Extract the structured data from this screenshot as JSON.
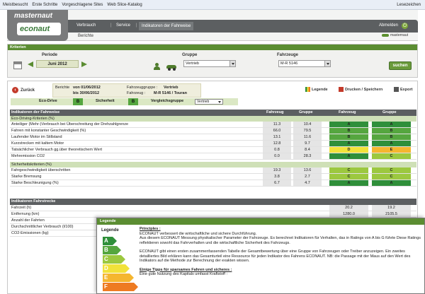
{
  "bookmarks": [
    "Meistbesucht",
    "Erste Schritte",
    "Vorgeschlagene Sites",
    "Web Slice-Katalog"
  ],
  "bookmarks_right": "Lesezeichen",
  "header": {
    "logo_top": "masternaut",
    "logo_bottom": "econaut",
    "nav": [
      "Verbrauch",
      "Service",
      "Indikatoren der Fahrweise"
    ],
    "logout": "Abmelden",
    "subnav": "Berichte",
    "brand": "masternaut"
  },
  "criteria": {
    "title": "Kriterien",
    "period_label": "Periode",
    "period_value": "Juni 2012",
    "group_label": "Gruppe",
    "group_value": "Vertrieb",
    "vehicle_label": "Fahrzeuge",
    "vehicle_value": "M-R 5146",
    "search_label": "suchen"
  },
  "report": {
    "back_label": "Zurück",
    "head": {
      "berichte": "Berichte",
      "von": "von 01/06/2012",
      "bis": "bis 30/06/2012",
      "fg_label": "Fahrzeuggruppe :",
      "fg_value": "Vertrieb",
      "fz_label": "Fahrzeug :",
      "fz_value": "M-R 5146 / Touran"
    },
    "tools": {
      "legend": "Legende",
      "print": "Drucken / Speichern",
      "export": "Export"
    },
    "summary": {
      "eco_label": "Eco-Drive",
      "eco_value": "B",
      "safety_label": "Sicherheit",
      "safety_value": "B",
      "compare_label": "Vergleichsgruppe",
      "compare_value": "Vertrieb"
    },
    "table_headers": [
      "Indikatoren der Fahrweise",
      "Fahrzeug",
      "Gruppe",
      "Fahrzeug",
      "Gruppe"
    ],
    "eco_section": "Eco-Driving-Kriterien (%)",
    "eco_rows": [
      {
        "name": "Anteiliger (Mehr-)Verbrauch bei Überschreitung der Drehzahlgrenze",
        "v1": "11.3",
        "v2": "10.4",
        "r1": "A",
        "r2": "A"
      },
      {
        "name": "Fahren mit konstanter Geschwindigkeit (%)",
        "v1": "66.0",
        "v2": "79.5",
        "r1": "B",
        "r2": "B"
      },
      {
        "name": "Laufender Motor im Stillstand",
        "v1": "13.1",
        "v2": "11.6",
        "r1": "B",
        "r2": "B"
      },
      {
        "name": "Kurzstrecken mit kaltem Motor",
        "v1": "12.8",
        "v2": "9.7",
        "r1": "A",
        "r2": "A"
      },
      {
        "name": "Tatsächlicher Verbrauch gg.über theoretischem Wert",
        "v1": "0.8",
        "v2": "8.4",
        "r1": "D",
        "r2": "E"
      },
      {
        "name": "Mehremission CO2",
        "v1": "0.0",
        "v2": "28.3",
        "r1": "A",
        "r2": "C"
      }
    ],
    "safety_section": "Sicherheitskriterien (%)",
    "safety_rows": [
      {
        "name": "Fahrgeschwindigkeit überschritten",
        "v1": "19.3",
        "v2": "13.6",
        "r1": "C",
        "r2": "C"
      },
      {
        "name": "Starke Bremsung",
        "v1": "3.8",
        "v2": "2.7",
        "r1": "C",
        "r2": "C"
      },
      {
        "name": "Starke Beschleunigung (%)",
        "v1": "6.7",
        "v2": "4.7",
        "r1": "A",
        "r2": "A"
      }
    ],
    "trip_header": "Indikatoren Fahrstrecke",
    "trip_rows": [
      {
        "name": "Fahrzeit (h)",
        "v1": "",
        "v2": "",
        "r1": "20.2",
        "r2": "19.2"
      },
      {
        "name": "Entfernung (km)",
        "v1": "",
        "v2": "",
        "r1": "1280.0",
        "r2": "2105.5"
      },
      {
        "name": "Anzahl der Fahrten",
        "v1": "",
        "v2": "",
        "r1": "",
        "r2": ""
      },
      {
        "name": "Durchschnittlicher Verbrauch (l/100)",
        "v1": "",
        "v2": "",
        "r1": "",
        "r2": ""
      },
      {
        "name": "CO2-Emissionen (kg)",
        "v1": "",
        "v2": "",
        "r1": "",
        "r2": ""
      }
    ]
  },
  "rating_colors": {
    "A": "#2f8f3a",
    "B": "#55a63f",
    "C": "#9cc83f",
    "D": "#f2e23a",
    "E": "#f5b62f",
    "F": "#ee7b22"
  },
  "legend_dialog": {
    "title": "Legende",
    "header": "Legende",
    "scale": [
      "A",
      "B",
      "C",
      "D",
      "E",
      "F"
    ],
    "principles_title": "Principles :",
    "principles_1": "ECONAUT verbessert die wirtschaftliche und sichere Durchführung.",
    "principles_2": "Aus diesem ECONAUT Messung physikalischer Parameter der Fahrzeuge. Es berechnet Indikatoren für Verhalten, das in Ratings von A bis G führte Diese Ratings reflektieren sowohl das Fahrverhalten und die wirtschaftliche Sicherheit des Fahrzeugs.",
    "para_2": "ECONAUT gibt einen ersten zusammenfassenden Tabelle der Gesamtbewertung über eine Gruppe von Fahrzeugen oder Treiber anzuzeigen. Ein zweites detailliertes Bild erklären kann das Gesamturteil eine Ressource für jeden Indikator des Fahrens ECONAUT. NB: die Passage mit der Maus auf den Wert des Indikators auf die Methode zur Berechnung der exakten wissen.",
    "tips_title": "Einige Tipps für sparsames Fahren und sicheres :",
    "tips_1": "Eine gute Nutzung des Kapitals umfasst Kraftstoff :"
  }
}
